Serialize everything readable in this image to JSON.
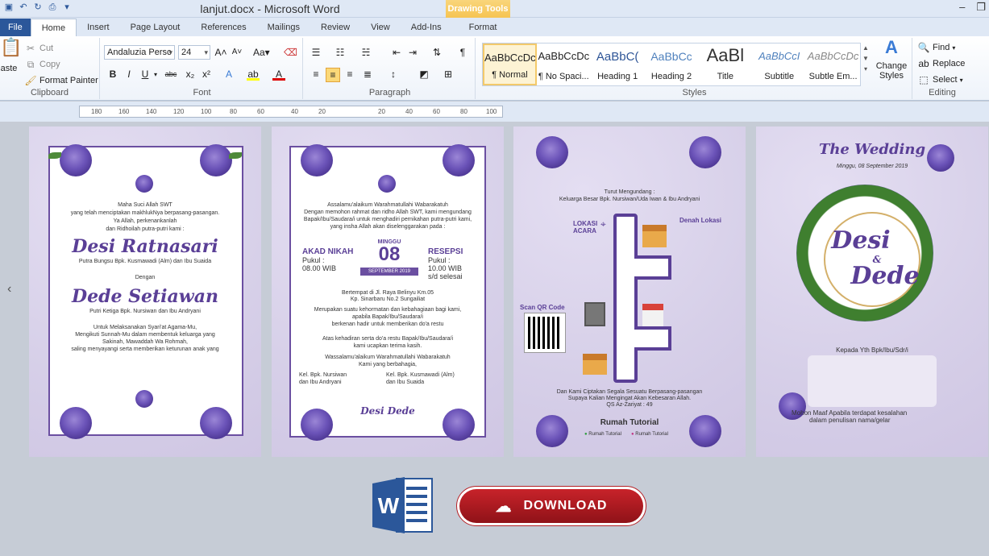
{
  "app": {
    "title": "lanjut.docx  -  Microsoft Word",
    "context_tab_group": "Drawing Tools"
  },
  "tabs": [
    "File",
    "Home",
    "Insert",
    "Page Layout",
    "References",
    "Mailings",
    "Review",
    "View",
    "Add-Ins",
    "Format"
  ],
  "clipboard": {
    "paste": "aste",
    "cut": "Cut",
    "copy": "Copy",
    "format_painter": "Format Painter",
    "label": "Clipboard"
  },
  "font": {
    "name": "Andaluzia Persc",
    "size": "24",
    "label": "Font"
  },
  "paragraph": {
    "label": "Paragraph"
  },
  "styles": {
    "label": "Styles",
    "items": [
      {
        "sample": "AaBbCcDc",
        "name": "¶ Normal"
      },
      {
        "sample": "AaBbCcDc",
        "name": "¶ No Spaci..."
      },
      {
        "sample": "AaBbC(",
        "name": "Heading 1"
      },
      {
        "sample": "AaBbCc",
        "name": "Heading 2"
      },
      {
        "sample": "AaBl",
        "name": "Title"
      },
      {
        "sample": "AaBbCcI",
        "name": "Subtitle"
      },
      {
        "sample": "AaBbCcDc",
        "name": "Subtle Em..."
      }
    ],
    "change_styles": "Change Styles"
  },
  "editing": {
    "find": "Find",
    "replace": "Replace",
    "select": "Select",
    "label": "Editing"
  },
  "ruler": [
    "180",
    "160",
    "140",
    "120",
    "100",
    "80",
    "60",
    "40",
    "20",
    "20",
    "40",
    "60",
    "80",
    "100"
  ],
  "page1": {
    "lines": [
      "Maha Suci Allah SWT",
      "yang telah menciptakan makhlukNya berpasang-pasangan.",
      "Ya Allah, perkenankanlah",
      "dan Ridhoilah  putra-putri kami :"
    ],
    "bride": "Desi Ratnasari",
    "bride_parents": "Putra Bungsu Bpk. Kusmawadi (Alm) dan Ibu Suaida",
    "with": "Dengan",
    "groom": "Dede Setiawan",
    "groom_parents": "Putri Ketiga Bpk. Nursiwan dan Ibu Andryani",
    "closing": [
      "Untuk Melaksanakan Syari'at Agama-Mu,",
      "Mengikuti Sunnah-Mu dalam membentuk keluarga yang",
      "Sakinah, Mawaddah Wa Rohmah,",
      "saling menyayangi serta memberikan keturunan anak yang"
    ]
  },
  "page2": {
    "opening": [
      "Assalamu'alaikum Warahmatullahi Wabarakatuh",
      "Dengan memohon rahmat dan ridho Allah SWT, kami mengundang",
      "Bapak/Ibu/Saudara/i untuk menghadiri pernikahan putra-putri kami,",
      "yang insha Allah akan diselenggarakan pada :"
    ],
    "akad_title": "AKAD NIKAH",
    "akad_time": "Pukul :",
    "akad_val": "08.00 WIB",
    "day": "MINGGU",
    "date": "08",
    "month": "SEPTEMBER 2019",
    "resepsi_title": "RESEPSI",
    "resepsi_time": "Pukul :",
    "resepsi_val": "10.00 WIB",
    "resepsi_end": "s/d selesai",
    "place": [
      "Bertempat di Jl. Raya Belinyu Km.05",
      "Kp. Sinarbaru No.2 Sungailiat"
    ],
    "honor": [
      "Merupakan suatu kehormatan dan kebahagiaan bagi kami,",
      "apabila Bapak/Ibu/Saudara/i",
      "berkenan hadir untuk memberikan do'a restu"
    ],
    "thanks": [
      "Atas kehadiran serta do'a restu Bapak/Ibu/Saudara/i",
      "kami ucapkan terima kasih."
    ],
    "closing": [
      "Wassalamu'alaikum Warahmatullahi Wabarakatuh",
      "Kami yang berbahagia,"
    ],
    "fam_left": [
      "Kel. Bpk. Nursiwan",
      "dan Ibu Andryani"
    ],
    "fam_right": [
      "Kel. Bpk. Kusmawadi (Alm)",
      "dan Ibu Suaida"
    ],
    "footer": "Desi  Dede"
  },
  "page3": {
    "invite": [
      "Turut Mengundang :",
      "Keluarga Besar Bpk. Nursiwan/Uda Iwan & Ibu Andryani"
    ],
    "lokasi": "LOKASI ACARA",
    "denah": "Denah Lokasi",
    "scan": "Scan QR Code",
    "verse": [
      "Dan Kami Ciptakan Segala Sesuatu Berpasang-pasangan",
      "Supaya Kalian Mengingat Akan Kebesaran Allah.",
      "QS Az-Zariyat : 49"
    ],
    "brand": "Rumah Tutorial",
    "social1": "Rumah Tutorial",
    "social2": "Rumah Tutorial"
  },
  "page4": {
    "title": "The Wedding",
    "date": "Minggu, 08 September 2019",
    "name1": "Desi",
    "amp": "&",
    "name2": "Dede",
    "kepada": "Kepada Yth Bpk/Ibu/Sdr/i",
    "mohon": [
      "Mohon Maaf Apabila terdapat kesalahan",
      "dalam penulisan nama/gelar"
    ]
  },
  "download": {
    "label": "DOWNLOAD"
  },
  "colors": {
    "accent": "#2b579a",
    "purple": "#5a3f96",
    "download": "#b52026"
  }
}
